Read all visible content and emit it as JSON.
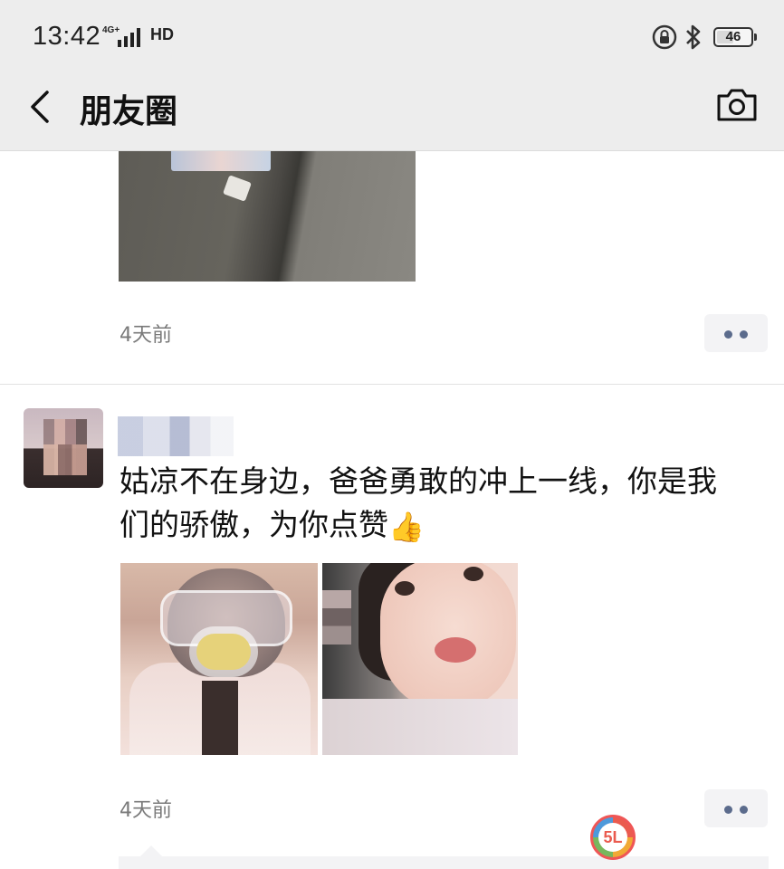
{
  "status_bar": {
    "time": "13:42",
    "network": "4G+",
    "hd": "HD",
    "battery_level": "46"
  },
  "nav": {
    "title": "朋友圈",
    "back_icon": "chevron-left-icon",
    "camera_icon": "camera-icon"
  },
  "posts": [
    {
      "time": "4天前"
    },
    {
      "text": "姑凉不在身边，爸爸勇敢的冲上一线，你是我们的骄傲，为你点赞",
      "emoji": "👍",
      "time": "4天前"
    }
  ],
  "watermark": {
    "text": "5L"
  },
  "colors": {
    "bar_bg": "#ededed",
    "more_dots": "#5b6b8c",
    "time_text": "#7a7a7a"
  }
}
